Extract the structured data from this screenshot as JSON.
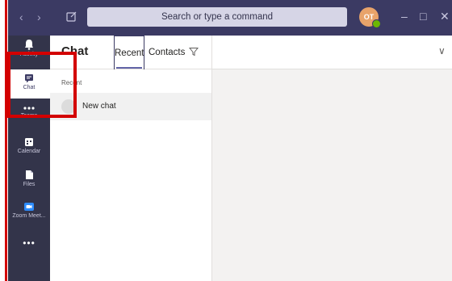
{
  "colors": {
    "titlebar": "#3b3a63",
    "rail": "#33344a",
    "accent": "#6264a7",
    "annotation": "#d30000"
  },
  "titlebar": {
    "back_icon": "chevron-left-icon",
    "forward_icon": "chevron-right-icon",
    "compose_icon": "compose-icon",
    "search_placeholder": "Search or type a command",
    "avatar_initials": "OT",
    "window_buttons": [
      "minimize",
      "maximize",
      "close"
    ]
  },
  "rail": {
    "items": [
      {
        "label": "Activity",
        "icon": "bell-icon"
      },
      {
        "label": "Chat",
        "icon": "chat-icon",
        "active": true
      },
      {
        "label": "Teams",
        "icon": "teams-icon"
      },
      {
        "label": "Calendar",
        "icon": "calendar-icon"
      },
      {
        "label": "Files",
        "icon": "file-icon"
      },
      {
        "label": "Zoom Meet...",
        "icon": "video-icon"
      }
    ],
    "more_icon": "more-icon"
  },
  "listpane": {
    "title": "Chat",
    "tabs": [
      {
        "label": "Recent",
        "active": true
      },
      {
        "label": "Contacts"
      }
    ],
    "filter_icon": "filter-icon",
    "section_label": "Recent",
    "chats": [
      {
        "name": "New chat"
      }
    ]
  },
  "main": {
    "expand_icon": "chevron-down-icon"
  }
}
